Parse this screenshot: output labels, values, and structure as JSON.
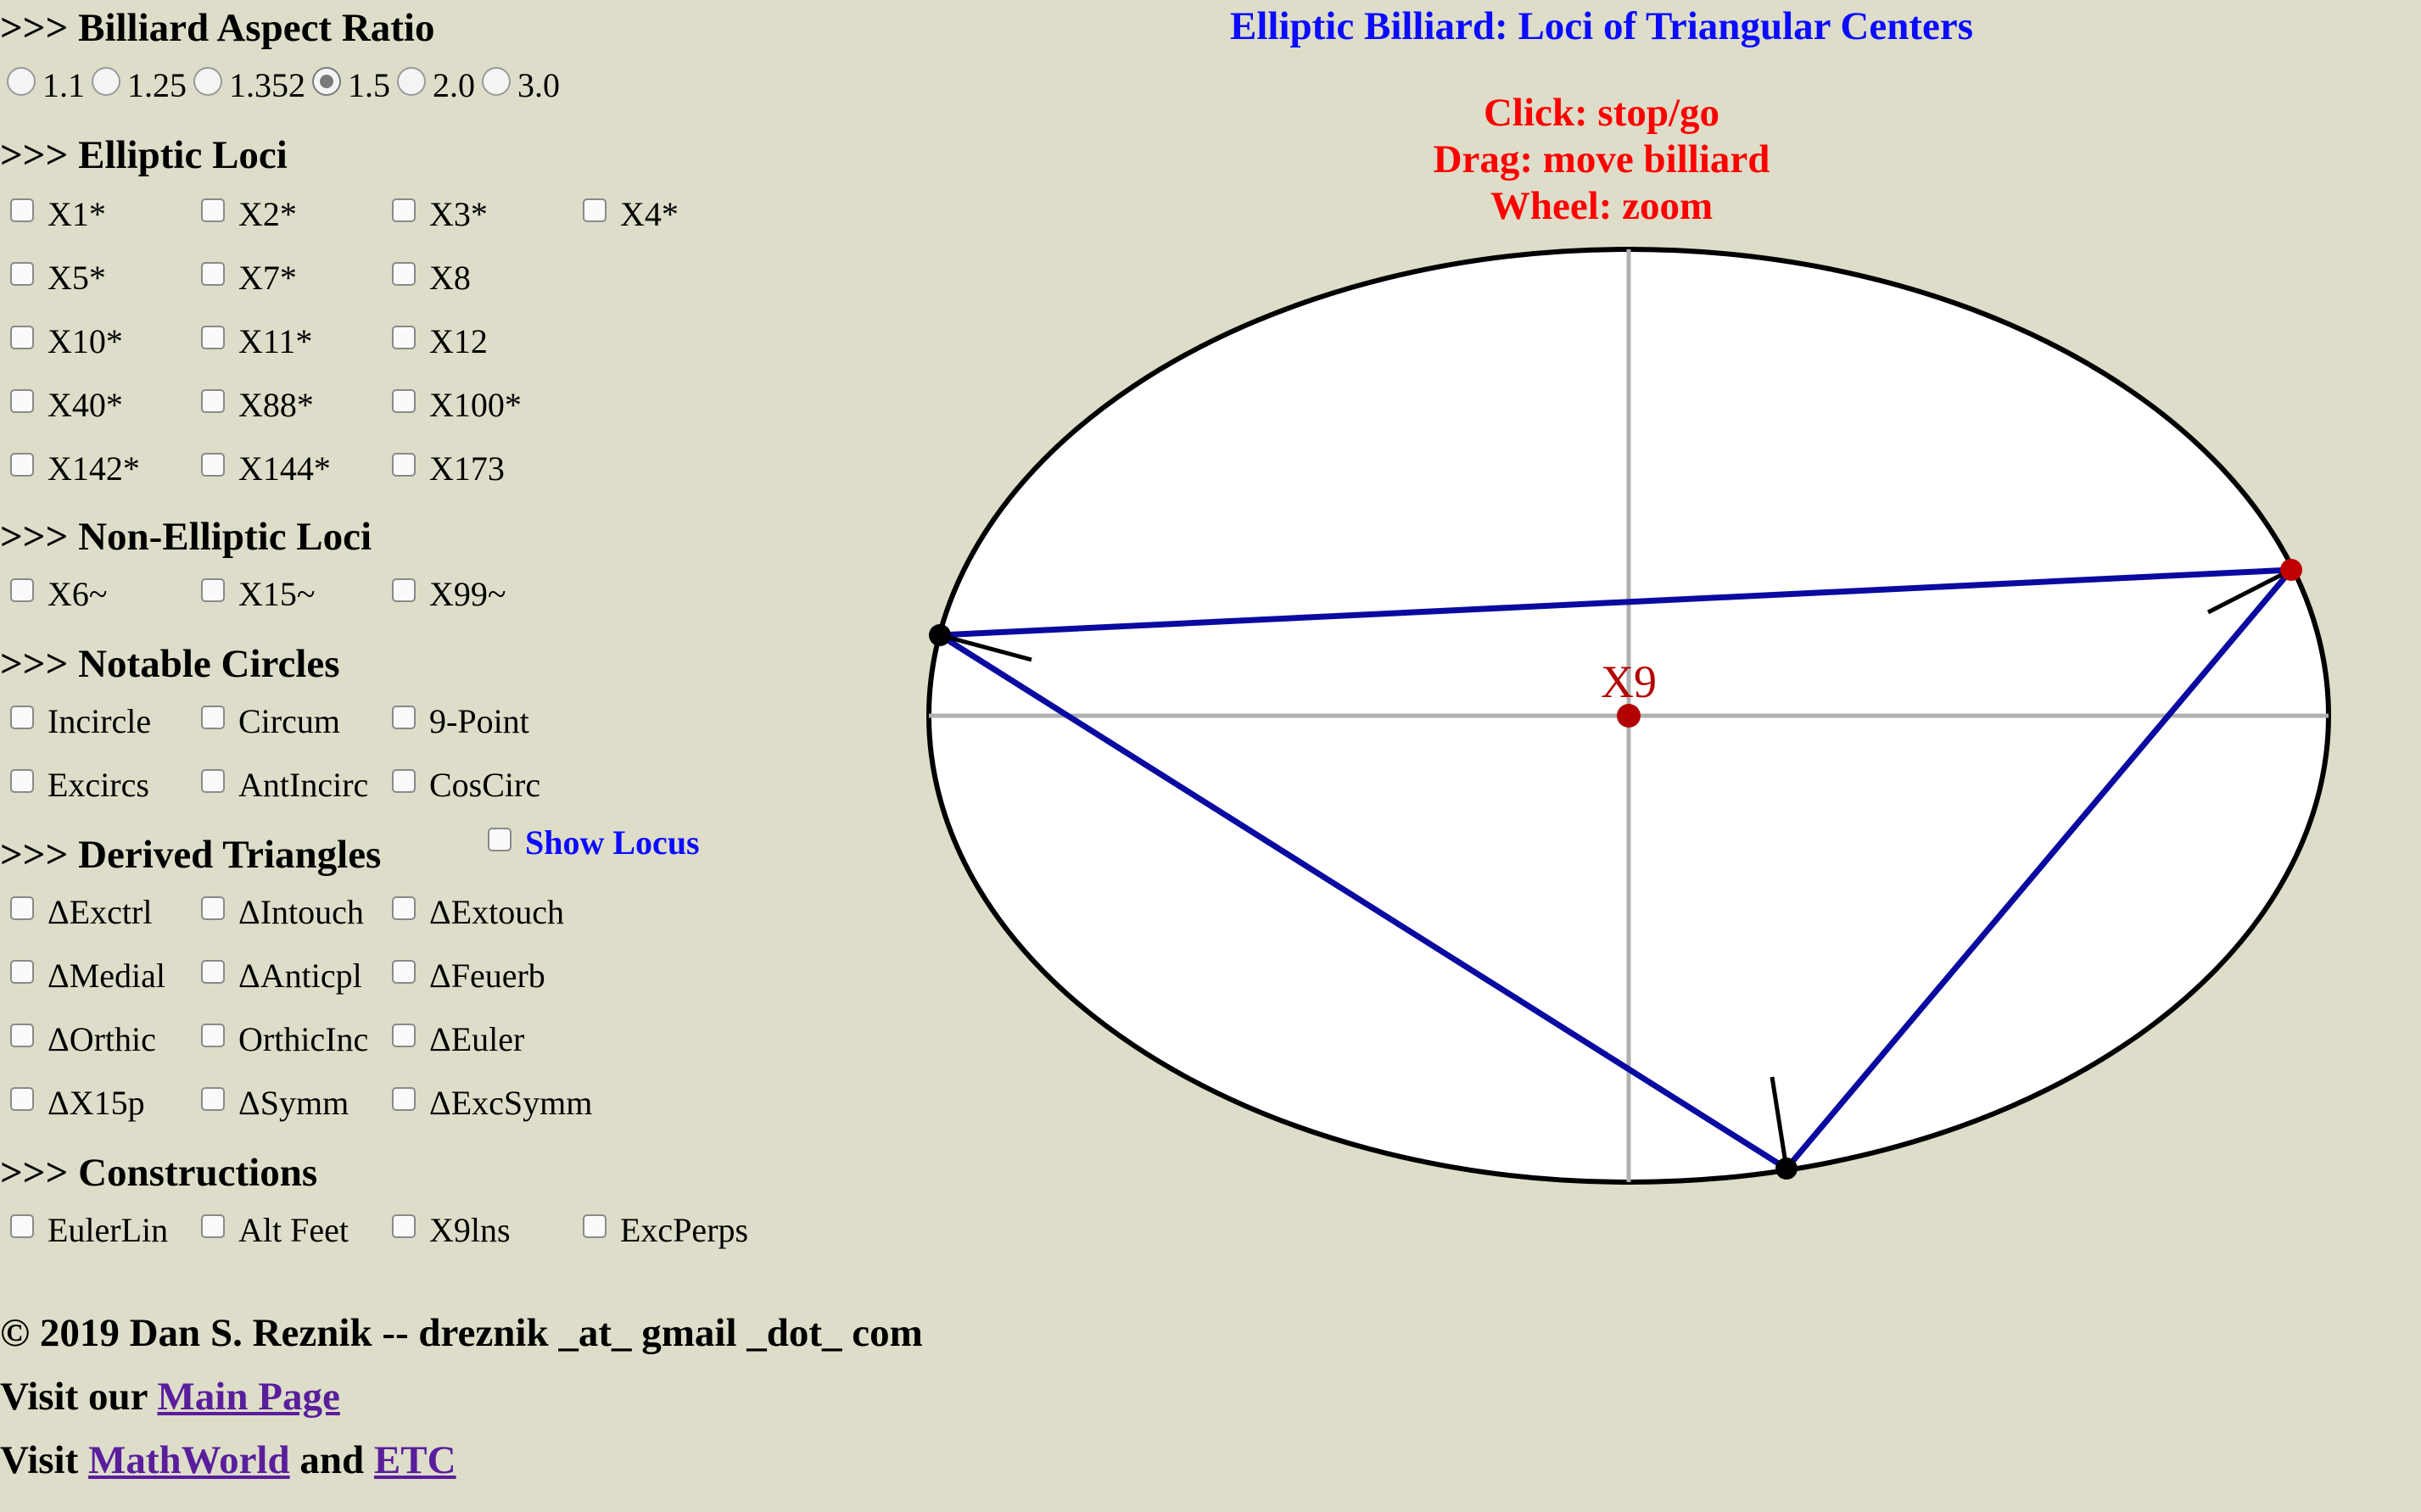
{
  "aspect": {
    "heading": ">>> Billiard Aspect Ratio",
    "options": [
      "1.1",
      "1.25",
      "1.352",
      "1.5",
      "2.0",
      "3.0"
    ],
    "selected": "1.5"
  },
  "elliptic_loci": {
    "heading": ">>> Elliptic Loci",
    "rows": [
      [
        "X1*",
        "X2*",
        "X3*",
        "X4*"
      ],
      [
        "X5*",
        "X7*",
        "X8"
      ],
      [
        "X10*",
        "X11*",
        "X12"
      ],
      [
        "X40*",
        "X88*",
        "X100*"
      ],
      [
        "X142*",
        "X144*",
        "X173"
      ]
    ]
  },
  "non_elliptic_loci": {
    "heading": ">>> Non-Elliptic Loci",
    "rows": [
      [
        "X6~",
        "X15~",
        "X99~"
      ]
    ]
  },
  "notable_circles": {
    "heading": ">>> Notable Circles",
    "rows": [
      [
        "Incircle",
        "Circum",
        "9-Point"
      ],
      [
        "Excircs",
        "AntIncirc",
        "CosCirc"
      ]
    ]
  },
  "derived_triangles": {
    "heading": ">>> Derived Triangles",
    "show_locus": "Show Locus",
    "rows": [
      [
        "ΔExctrl",
        "ΔIntouch",
        "ΔExtouch"
      ],
      [
        "ΔMedial",
        "ΔAnticpl",
        "ΔFeuerb"
      ],
      [
        "ΔOrthic",
        "OrthicInc",
        "ΔEuler"
      ],
      [
        "ΔX15p",
        "ΔSymm",
        "ΔExcSymm"
      ]
    ]
  },
  "constructions": {
    "heading": ">>> Constructions",
    "rows": [
      [
        "EulerLin",
        "Alt Feet",
        "X9lns",
        "ExcPerps"
      ]
    ]
  },
  "footer": {
    "copyright": "© 2019 Dan S. Reznik -- dreznik _at_ gmail _dot_ com",
    "visit_our": "Visit our",
    "main_page": "Main Page",
    "visit": "Visit",
    "mathworld": "MathWorld",
    "and": "and",
    "etc": "ETC"
  },
  "canvas": {
    "title": "Elliptic Billiard: Loci of Triangular Centers",
    "hints": [
      "Click: stop/go",
      "Drag: move billiard",
      "Wheel: zoom"
    ],
    "center_label": "X9",
    "colors": {
      "title": "#0b0bff",
      "hint": "#ff0000",
      "triangle": "#0a0aa0",
      "center": "#b30000",
      "axes": "#b0b0b0"
    }
  }
}
